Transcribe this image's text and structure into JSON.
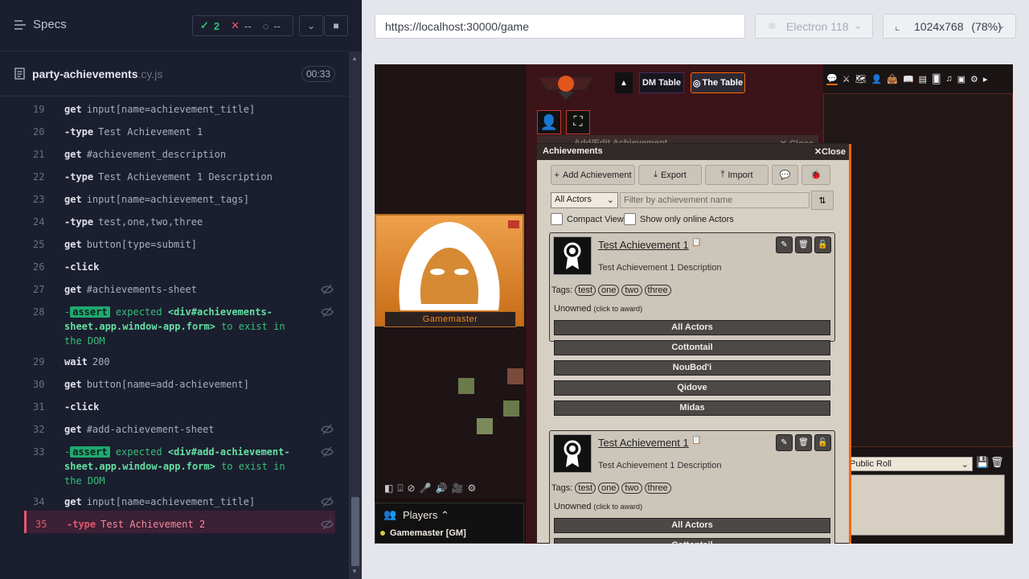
{
  "runner": {
    "specs_label": "Specs",
    "stats": {
      "passed": "2",
      "failed": "--",
      "pending": "--"
    },
    "file": {
      "name": "party-achievements",
      "ext": ".cy.js",
      "duration": "00:33"
    },
    "commands": [
      {
        "ln": "19",
        "name": "get",
        "arg": "input[name=achievement_title]"
      },
      {
        "ln": "20",
        "name": "-type",
        "arg": "Test Achievement 1"
      },
      {
        "ln": "21",
        "name": "get",
        "arg": "#achievement_description"
      },
      {
        "ln": "22",
        "name": "-type",
        "arg": "Test Achievement 1 Description"
      },
      {
        "ln": "23",
        "name": "get",
        "arg": "input[name=achievement_tags]"
      },
      {
        "ln": "24",
        "name": "-type",
        "arg": "test,one,two,three"
      },
      {
        "ln": "25",
        "name": "get",
        "arg": "button[type=submit]"
      },
      {
        "ln": "26",
        "name": "-click",
        "arg": ""
      },
      {
        "ln": "27",
        "name": "get",
        "arg": "#achievements-sheet"
      },
      {
        "ln": "29",
        "name": "wait",
        "arg": "200"
      },
      {
        "ln": "30",
        "name": "get",
        "arg": "button[name=add-achievement]"
      },
      {
        "ln": "31",
        "name": "-click",
        "arg": ""
      },
      {
        "ln": "32",
        "name": "get",
        "arg": "#add-achievement-sheet"
      },
      {
        "ln": "34",
        "name": "get",
        "arg": "input[name=achievement_title]"
      },
      {
        "ln": "35",
        "name": "-type",
        "arg": "Test Achievement 2"
      }
    ],
    "asserts": [
      {
        "ln": "28",
        "badge": "assert",
        "expected": "expected",
        "target": "<div#achievements-sheet.app.window-app.form>",
        "rest": "to exist in the DOM"
      },
      {
        "ln": "33",
        "badge": "assert",
        "expected": "expected",
        "target": "<div#add-achievement-sheet.app.window-app.form>",
        "rest": "to exist in the DOM"
      }
    ]
  },
  "browser": {
    "url": "https://localhost:30000/game",
    "engine": "Electron 118",
    "viewport": "1024x768",
    "zoom": "(78%)"
  },
  "game": {
    "dm_table": "DM Table",
    "the_table": "The Table",
    "gm_label": "Gamemaster",
    "players_title": "Players",
    "player_gm": "Gamemaster [GM]",
    "roll_mode": "Public Roll",
    "add_window_title": "Add/Edit Achievement",
    "add_window_close": "Close",
    "ach_window": {
      "title": "Achievements",
      "close": "Close",
      "toolbar": {
        "add": "Add Achievement",
        "export": "Export",
        "import": "Import"
      },
      "actor_select": "All Actors",
      "filter_placeholder": "Filter by achievement name",
      "compact": "Compact View",
      "online_only": "Show only online Actors",
      "cards": [
        {
          "title": "Test Achievement 1",
          "desc": "Test Achievement 1 Description",
          "tags_label": "Tags:",
          "tags": [
            "test",
            "one",
            "two",
            "three"
          ],
          "unowned": "Unowned",
          "unowned_hint": "(click to award)",
          "actors": [
            "All Actors",
            "Cottontail",
            "NouBod'i",
            "Qidove",
            "Midas"
          ]
        },
        {
          "title": "Test Achievement 1",
          "desc": "Test Achievement 1 Description",
          "tags_label": "Tags:",
          "tags": [
            "test",
            "one",
            "two",
            "three"
          ],
          "unowned": "Unowned",
          "unowned_hint": "(click to award)",
          "actors": [
            "All Actors",
            "Cottontail"
          ]
        }
      ]
    }
  },
  "colors": {
    "pass": "#33c07a",
    "fail": "#e45770",
    "accent": "#ff6400"
  }
}
